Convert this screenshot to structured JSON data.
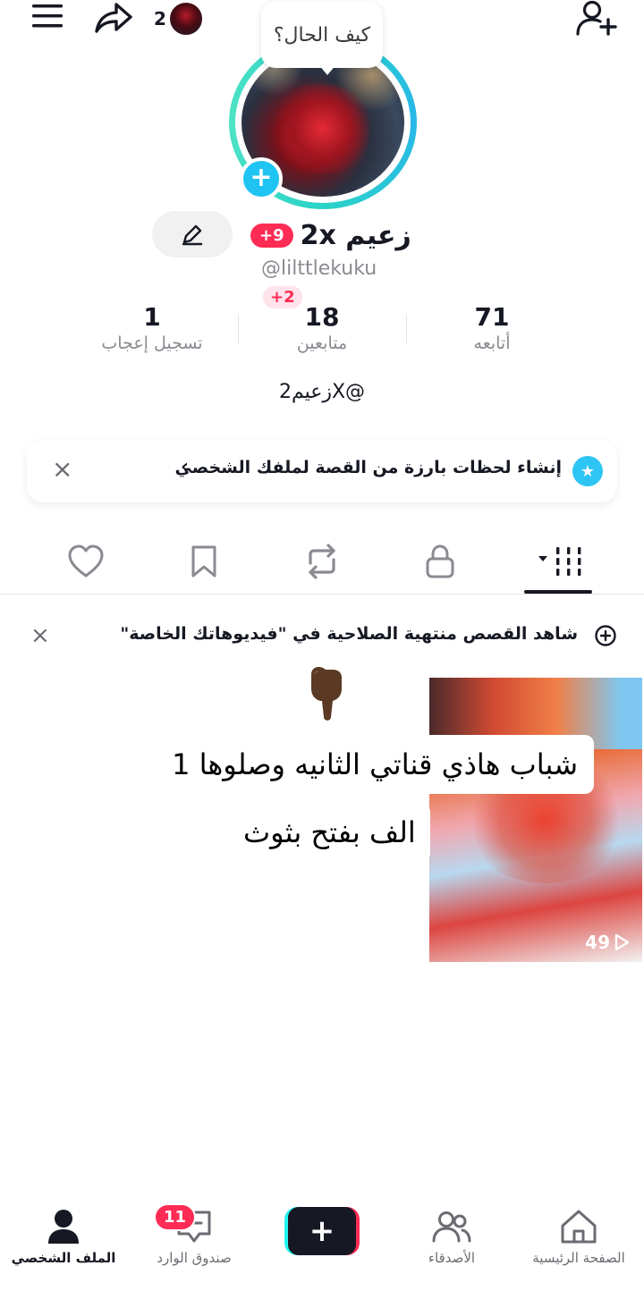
{
  "header": {
    "menu_icon": "hamburger-icon",
    "share_icon": "share-arrow-icon",
    "add_friend_icon": "person-add-icon",
    "mini_avatar_count": "2",
    "status_bubble": "كيف الحال؟"
  },
  "profile": {
    "name": "زعيم 2x",
    "name_badge": "+9",
    "handle": "@lilttlekuku",
    "new_badge": "+2",
    "bio": "زعيم2X@",
    "edit_icon": "pencil-icon",
    "accent_color": "#2bd3c7"
  },
  "stats": [
    {
      "value": "71",
      "label": "أتابعه"
    },
    {
      "value": "18",
      "label": "متابعين"
    },
    {
      "value": "1",
      "label": "تسجيل إعجاب"
    }
  ],
  "highlight_banner": {
    "text": "إنشاء لحظات بارزة من القصة لملفك الشخصي",
    "chevron": "‹",
    "close": "×"
  },
  "tabs": [
    {
      "name": "videos",
      "icon": "grid-icon",
      "active": true
    },
    {
      "name": "private",
      "icon": "lock-icon"
    },
    {
      "name": "reposts",
      "icon": "repost-icon"
    },
    {
      "name": "favorites",
      "icon": "bookmark-icon"
    },
    {
      "name": "liked",
      "icon": "heart-icon"
    }
  ],
  "notice": {
    "text": "شاهد القصص منتهية الصلاحية في \"فيديوهاتك الخاصة\"",
    "close": "×"
  },
  "video": {
    "caption_line1": "شباب هاذي قناتي الثانيه وصلوها 1",
    "caption_line2": "الف بفتح بثوث",
    "views": "49"
  },
  "bottom_nav": {
    "home": "الصفحة الرئيسية",
    "friends": "الأصدقاء",
    "create": "+",
    "inbox": "صندوق الوارد",
    "inbox_badge": "11",
    "profile": "الملف الشخصي"
  },
  "colors": {
    "brand_red": "#fe2c55",
    "brand_cyan": "#25f4ee",
    "text_primary": "#161823",
    "text_secondary": "#8a8b91"
  }
}
